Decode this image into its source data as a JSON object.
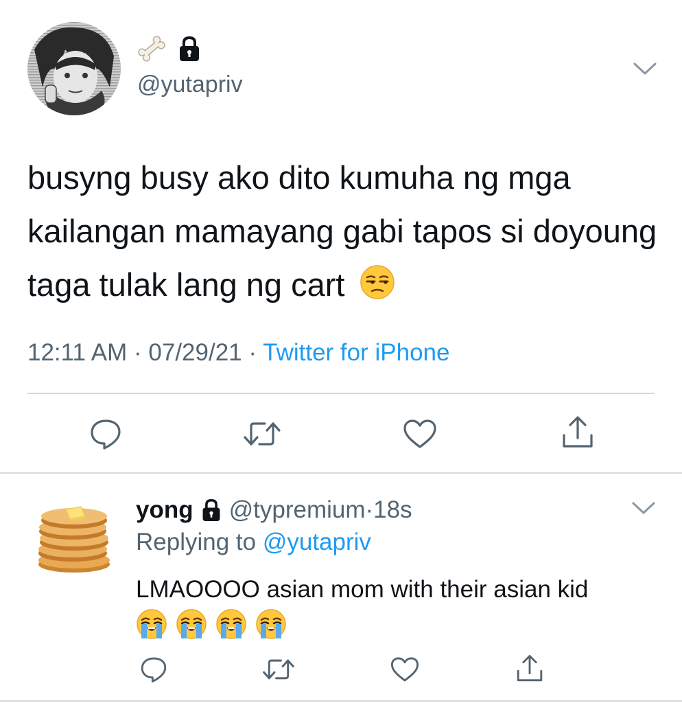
{
  "main_tweet": {
    "handle": "@yutapriv",
    "text": "busyng busy ako dito kumuha ng mga kailangan mamayang gabi tapos si doyoung taga tulak lang ng cart",
    "time": "12:11 AM",
    "date": "07/29/21",
    "source": "Twitter for iPhone",
    "separator": " · ",
    "name_icons": [
      "bone-icon",
      "lock-icon"
    ],
    "trailing_emoji": "unamused-face-icon"
  },
  "reply_tweet": {
    "name": "yong",
    "handle": "@typremium",
    "time": "18s",
    "separator": " · ",
    "replying_prefix": "Replying to ",
    "replying_to": "@yutapriv",
    "text": "LMAOOOO asian mom with their asian kid",
    "emoji_count": 4,
    "emoji_name": "loudly-crying-face-icon"
  },
  "actions": [
    "reply-icon",
    "retweet-icon",
    "like-icon",
    "share-icon"
  ],
  "colors": {
    "text": "#0f1419",
    "secondary": "#536471",
    "link": "#1d9bf0",
    "divider": "#d6d9db",
    "icon": "#536471"
  }
}
